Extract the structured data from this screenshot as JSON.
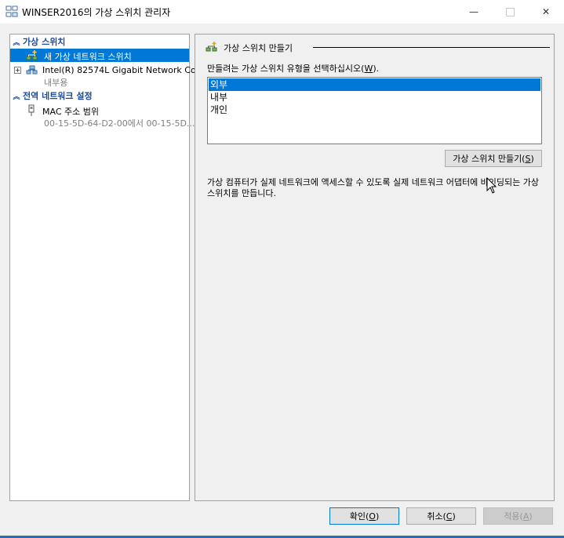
{
  "window": {
    "title": "WINSER2016의 가상 스위치 관리자",
    "minimize_glyph": "—",
    "close_glyph": "✕"
  },
  "tree": {
    "section_virtual_switch": "가상 스위치",
    "new_switch_label": "새 가상 네트워크 스위치",
    "adapter_label": "Intel(R) 82574L Gigabit Network Co...",
    "adapter_sub": "내부용",
    "section_global": "전역 네트워크 설정",
    "mac_label": "MAC 주소 범위",
    "mac_sub": "00-15-5D-64-D2-00에서 00-15-5D..."
  },
  "panel": {
    "group_title": "가상 스위치 만들기",
    "prompt_prefix": "만들려는 가상 스위치 유형을 선택하십시오(",
    "prompt_key": "W",
    "prompt_suffix": ").",
    "options": [
      "외부",
      "내부",
      "개인"
    ],
    "selected_index": 0,
    "create_prefix": "가상 스위치 만들기(",
    "create_key": "S",
    "create_suffix": ")",
    "description": "가상 컴퓨터가 실제 네트워크에 액세스할 수 있도록 실제 네트워크 어댑터에 바인딩되는 가상 스위치를 만듭니다."
  },
  "buttons": {
    "ok_prefix": "확인(",
    "ok_key": "O",
    "ok_suffix": ")",
    "cancel_prefix": "취소(",
    "cancel_key": "C",
    "cancel_suffix": ")",
    "apply_prefix": "적용(",
    "apply_key": "A",
    "apply_suffix": ")"
  },
  "colors": {
    "selection": "#0078d7",
    "section_heading": "#1a4a9a"
  }
}
